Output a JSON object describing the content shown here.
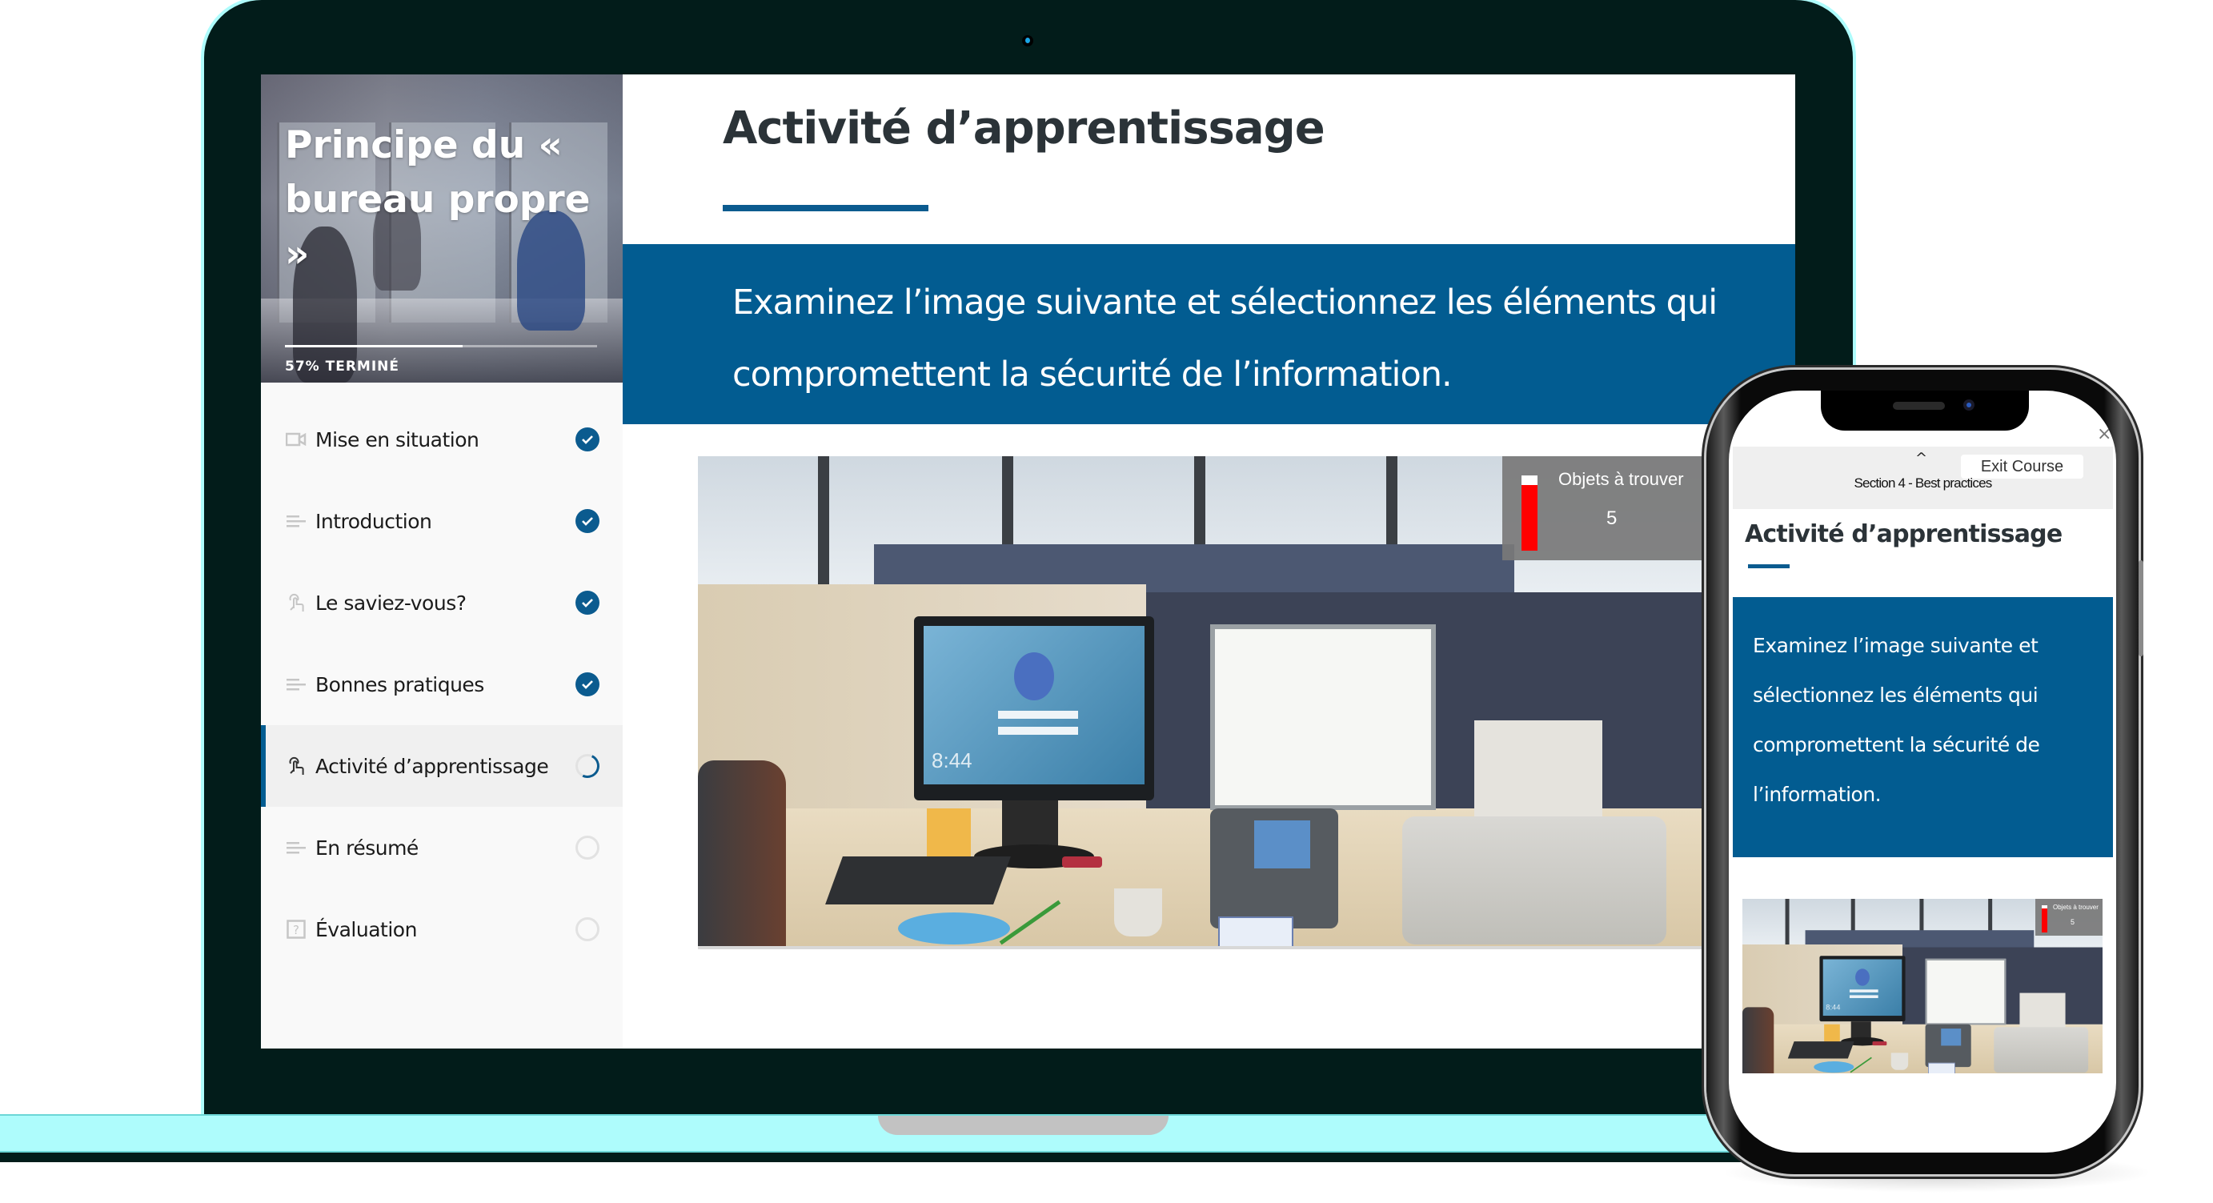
{
  "laptop": {
    "course": {
      "title": "Principe du « bureau propre »",
      "progress_percent": 57,
      "progress_label": "57% TERMINÉ"
    },
    "sidebar": {
      "items": [
        {
          "label": "Mise en situation",
          "icon": "video-icon",
          "status": "completed"
        },
        {
          "label": "Introduction",
          "icon": "text-lines-icon",
          "status": "completed"
        },
        {
          "label": "Le saviez-vous?",
          "icon": "touch-interaction-icon",
          "status": "completed"
        },
        {
          "label": "Bonnes pratiques",
          "icon": "text-lines-icon",
          "status": "completed"
        },
        {
          "label": "Activité d’apprentissage",
          "icon": "touch-interaction-icon",
          "status": "in-progress",
          "active": true
        },
        {
          "label": "En résumé",
          "icon": "text-lines-icon",
          "status": "not-started"
        },
        {
          "label": "Évaluation",
          "icon": "quiz-question-icon",
          "status": "not-started"
        }
      ]
    },
    "main": {
      "title": "Activité d’apprentissage",
      "instruction": "Examinez l’image suivante et sélectionnez les éléments qui compromettent la sécurité de l’information.",
      "hotspot_image": {
        "description": "Office cubicle desk scene",
        "clock_on_monitor": "8:44"
      },
      "counter": {
        "label": "Objets à trouver",
        "value": "5",
        "remaining_fraction": 0.87
      }
    }
  },
  "phone": {
    "close_label": "×",
    "exit_label": "Exit Course",
    "section_label": "Section 4 - Best practices",
    "collapse_icon": "^",
    "title": "Activité d’apprentissage",
    "instruction": "Examinez l’image suivante et sélectionnez les éléments qui compromettent la sécurité de l’information.",
    "counter": {
      "label": "Objets à trouver",
      "value": "5",
      "remaining_fraction": 0.87
    }
  },
  "colors": {
    "accent_blue": "#025c91",
    "check_blue": "#0b5b8f",
    "laptop_bezel": "#021c1a",
    "laptop_outline": "#aefcfc",
    "counter_bar": "#ff0000"
  }
}
